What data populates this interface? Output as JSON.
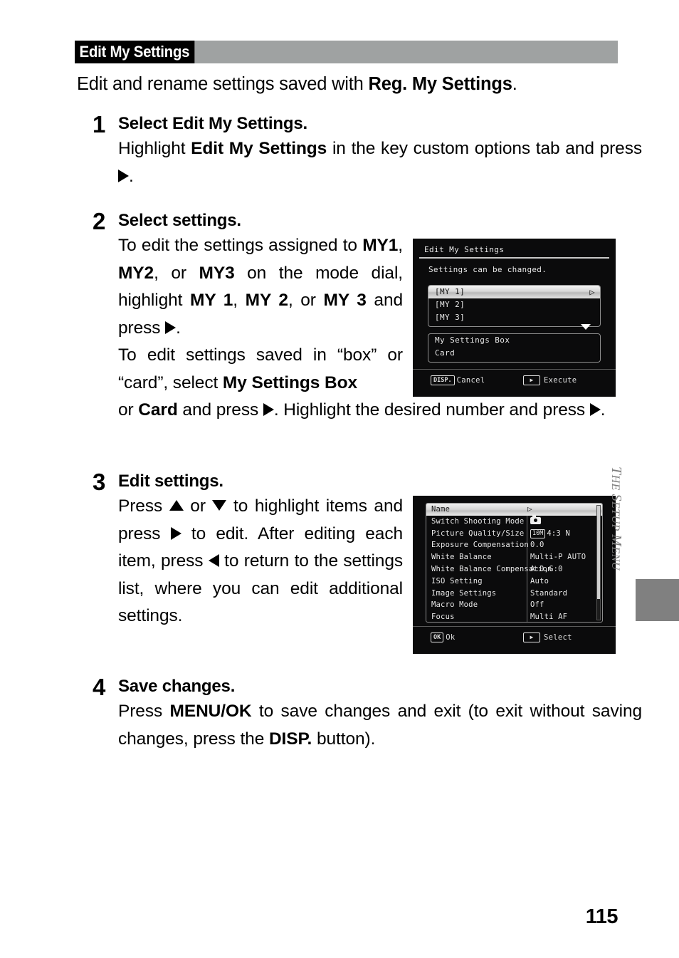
{
  "header": {
    "section_tag": "Edit My Settings"
  },
  "intro": {
    "prefix": "Edit and rename settings saved with ",
    "bold": "Reg. My Settings",
    "suffix": "."
  },
  "steps": [
    {
      "number": "1",
      "title_prefix": "Select ",
      "title_bold": "Edit My Settings",
      "title_suffix": ".",
      "text_a": "Highlight ",
      "text_b": "Edit My Settings",
      "text_c": " in the key custom options tab and press ",
      "text_d": "."
    },
    {
      "number": "2",
      "title": "Select settings.",
      "p1_a": "To edit the settings assigned to ",
      "p1_b": "MY1",
      "p1_c": ", ",
      "p1_d": "MY2",
      "p1_e": ", or ",
      "p1_f": "MY3",
      "p1_g": " on the mode dial, highlight ",
      "p1_h": "MY 1",
      "p1_i": ", ",
      "p1_j": "MY 2",
      "p1_k": ", or ",
      "p1_l": "MY 3",
      "p1_m": " and press ",
      "p1_n": ".",
      "p2_a": "To edit settings saved in “box” or “card”, select ",
      "p2_b": "My Settings Box",
      "p2_c": " or ",
      "p2_d": "Card",
      "p2_e": " and press ",
      "p2_f": ". Highlight the desired number and press ",
      "p2_g": "."
    },
    {
      "number": "3",
      "title": "Edit settings.",
      "t_a": "Press ",
      "t_b": " or ",
      "t_c": " to highlight items and press ",
      "t_d": " to edit. After editing each item, press ",
      "t_e": " to return to the settings list, where you can edit additional settings."
    },
    {
      "number": "4",
      "title": "Save changes.",
      "t_a": "Press ",
      "t_b": "MENU/OK",
      "t_c": " to save changes and exit (to exit without saving changes, press the ",
      "t_d": "DISP.",
      "t_e": " button)."
    }
  ],
  "lcd_edit_my_settings": {
    "title": "Edit My Settings",
    "message": "Settings can be changed.",
    "my_list": [
      {
        "label": "[MY 1]",
        "selected": true,
        "arrow": "▷"
      },
      {
        "label": "[MY 2]",
        "selected": false,
        "arrow": ""
      },
      {
        "label": "[MY 3]",
        "selected": false,
        "arrow": ""
      }
    ],
    "dest_list": [
      {
        "label": "My Settings Box"
      },
      {
        "label": "Card"
      }
    ],
    "footer": {
      "left_key": "DISP.",
      "left_label": "Cancel",
      "right_key": "▶",
      "right_label": "Execute"
    }
  },
  "lcd_settings_list": {
    "rows": [
      {
        "label": "Name",
        "value": "",
        "selected": true,
        "arrow": "▷"
      },
      {
        "label": "Switch Shooting Mode",
        "value": "",
        "icon": "camera-icon"
      },
      {
        "label": "Picture Quality/Size",
        "value": "4:3 N",
        "badge": "10M"
      },
      {
        "label": "Exposure Compensation",
        "value": "0.0"
      },
      {
        "label": "White Balance",
        "value": "Multi-P AUTO"
      },
      {
        "label": "White Balance Compensation",
        "value": "A:0,G:0"
      },
      {
        "label": "ISO Setting",
        "value": "Auto"
      },
      {
        "label": "Image Settings",
        "value": "Standard"
      },
      {
        "label": "Macro Mode",
        "value": "Off"
      },
      {
        "label": "Focus",
        "value": "Multi AF"
      }
    ],
    "footer": {
      "left_key": "OK",
      "left_label": "Ok",
      "right_key": "▶",
      "right_label": "Select"
    }
  },
  "side_tab": {
    "label_cap_t": "T",
    "label_rest_1": "HE ",
    "label_cap_s": "S",
    "label_rest_2": "ETUP ",
    "label_cap_m": "M",
    "label_rest_3": "ENU"
  },
  "page_number": "115",
  "colors": {
    "header_gray": "#9fa2a2",
    "header_black": "#000000",
    "side_tab_gray": "#808080",
    "lcd_background": "#0b0b0c"
  }
}
